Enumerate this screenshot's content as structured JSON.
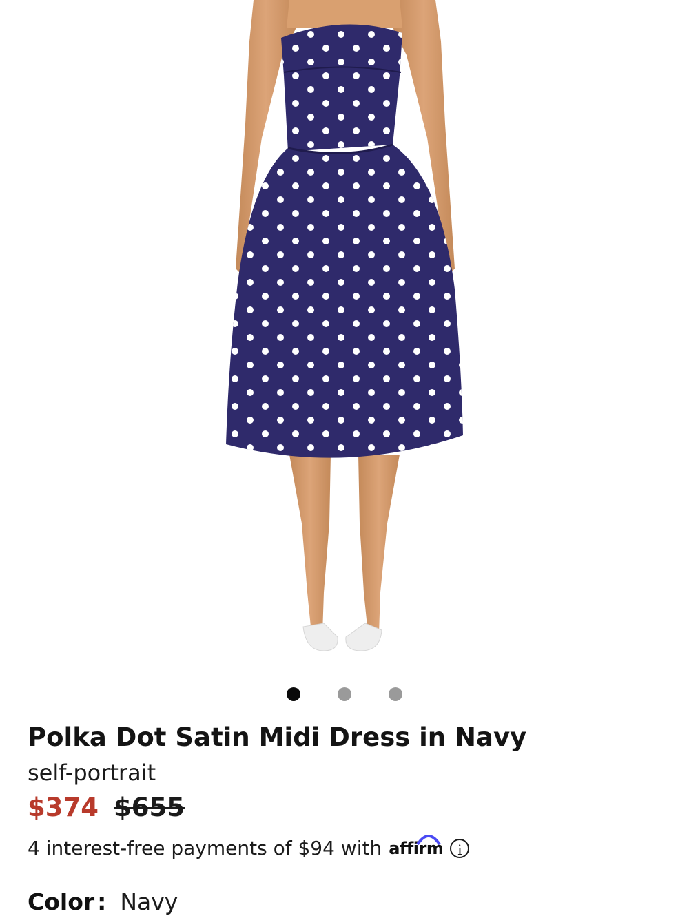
{
  "product": {
    "title": "Polka Dot Satin Midi Dress in Navy",
    "brand": "self-portrait",
    "price_sale": "$374",
    "price_original": "$655",
    "payment": {
      "text": "4 interest-free payments of $94 with",
      "provider": "affirm"
    },
    "color_label": "Color",
    "color_colon": ":",
    "color_value": "Navy"
  },
  "gallery": {
    "total_images": 3,
    "active_index": 0
  },
  "colors": {
    "dress": "#2f2a6b",
    "dots": "#ffffff",
    "sale_price": "#b83a2b",
    "affirm_accent": "#4a4af4"
  }
}
